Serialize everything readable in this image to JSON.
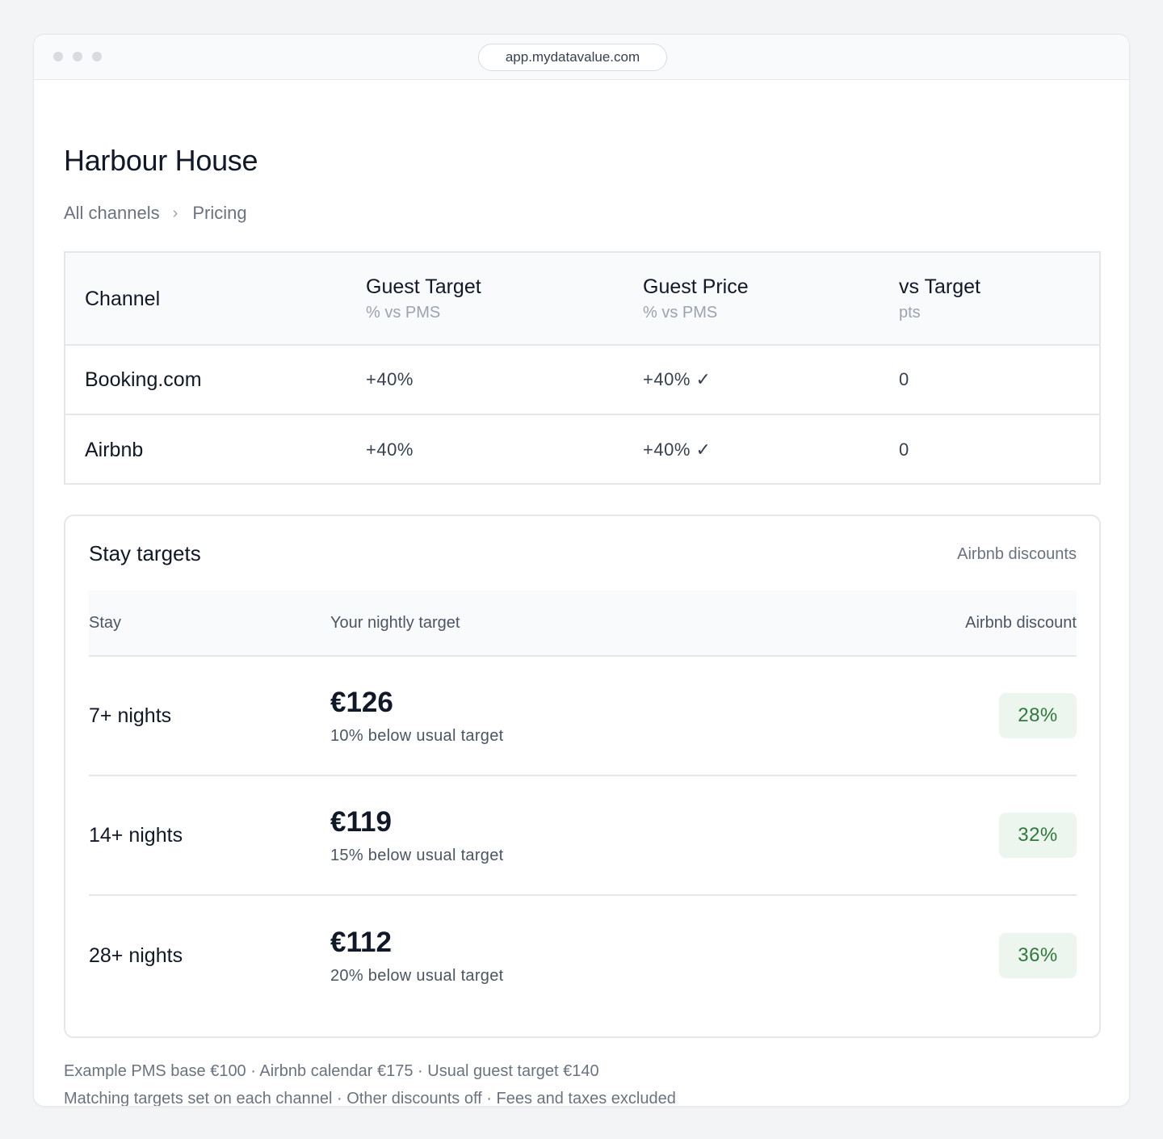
{
  "browser": {
    "url": "app.mydatavalue.com"
  },
  "page": {
    "title": "Harbour House",
    "breadcrumb": {
      "parent": "All channels",
      "separator": "›",
      "current": "Pricing"
    }
  },
  "channels_table": {
    "headers": [
      {
        "label": "Channel",
        "sub": ""
      },
      {
        "label": "Guest Target",
        "sub": "% vs PMS"
      },
      {
        "label": "Guest Price",
        "sub": "% vs PMS"
      },
      {
        "label": "vs Target",
        "sub": "pts"
      }
    ],
    "rows": [
      {
        "channel": "Booking.com",
        "guest_target": "+40%",
        "guest_price": "+40% ✓",
        "vs_target": "0"
      },
      {
        "channel": "Airbnb",
        "guest_target": "+40%",
        "guest_price": "+40% ✓",
        "vs_target": "0"
      }
    ]
  },
  "stay_targets": {
    "title": "Stay targets",
    "link": "Airbnb discounts",
    "headers": {
      "stay": "Stay",
      "target": "Your nightly target",
      "discount": "Airbnb discount"
    },
    "rows": [
      {
        "stay": "7+ nights",
        "price": "€126",
        "note": "10% below usual target",
        "discount": "28%"
      },
      {
        "stay": "14+ nights",
        "price": "€119",
        "note": "15% below usual target",
        "discount": "32%"
      },
      {
        "stay": "28+ nights",
        "price": "€112",
        "note": "20% below usual target",
        "discount": "36%"
      }
    ]
  },
  "footer": {
    "line1": "Example PMS base €100 · Airbnb calendar €175 · Usual guest target €140",
    "line2": "Matching targets set on each channel · Other discounts off · Fees and taxes excluded"
  },
  "colors": {
    "accent_green": "#2f7a3a",
    "badge_bg": "#edf6ee",
    "border": "#e5e7eb"
  }
}
